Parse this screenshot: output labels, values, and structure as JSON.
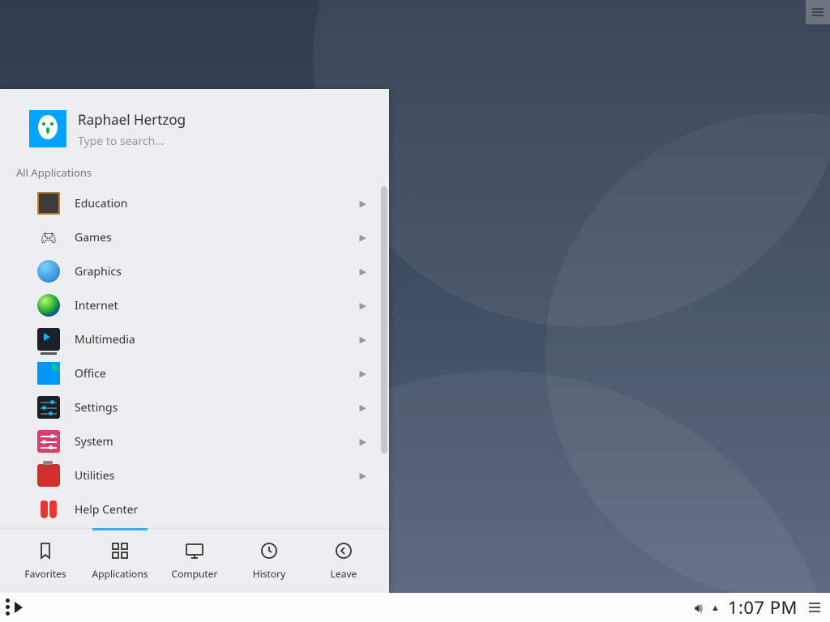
{
  "user": {
    "name": "Raphael Hertzog"
  },
  "search": {
    "placeholder": "Type to search..."
  },
  "section_label": "All Applications",
  "categories": [
    {
      "label": "Education",
      "icon": "education-icon",
      "submenu": true
    },
    {
      "label": "Games",
      "icon": "games-icon",
      "submenu": true
    },
    {
      "label": "Graphics",
      "icon": "graphics-icon",
      "submenu": true
    },
    {
      "label": "Internet",
      "icon": "internet-icon",
      "submenu": true
    },
    {
      "label": "Multimedia",
      "icon": "multimedia-icon",
      "submenu": true
    },
    {
      "label": "Office",
      "icon": "office-icon",
      "submenu": true
    },
    {
      "label": "Settings",
      "icon": "settings-icon",
      "submenu": true
    },
    {
      "label": "System",
      "icon": "system-icon",
      "submenu": true
    },
    {
      "label": "Utilities",
      "icon": "utilities-icon",
      "submenu": true
    },
    {
      "label": "Help Center",
      "icon": "help-icon",
      "submenu": false
    }
  ],
  "tabs": [
    {
      "label": "Favorites",
      "icon": "bookmark-icon"
    },
    {
      "label": "Applications",
      "icon": "grid-icon"
    },
    {
      "label": "Computer",
      "icon": "monitor-icon"
    },
    {
      "label": "History",
      "icon": "clock-icon"
    },
    {
      "label": "Leave",
      "icon": "back-circle-icon"
    }
  ],
  "active_tab": 1,
  "tray": {
    "time": "1:07 PM"
  }
}
